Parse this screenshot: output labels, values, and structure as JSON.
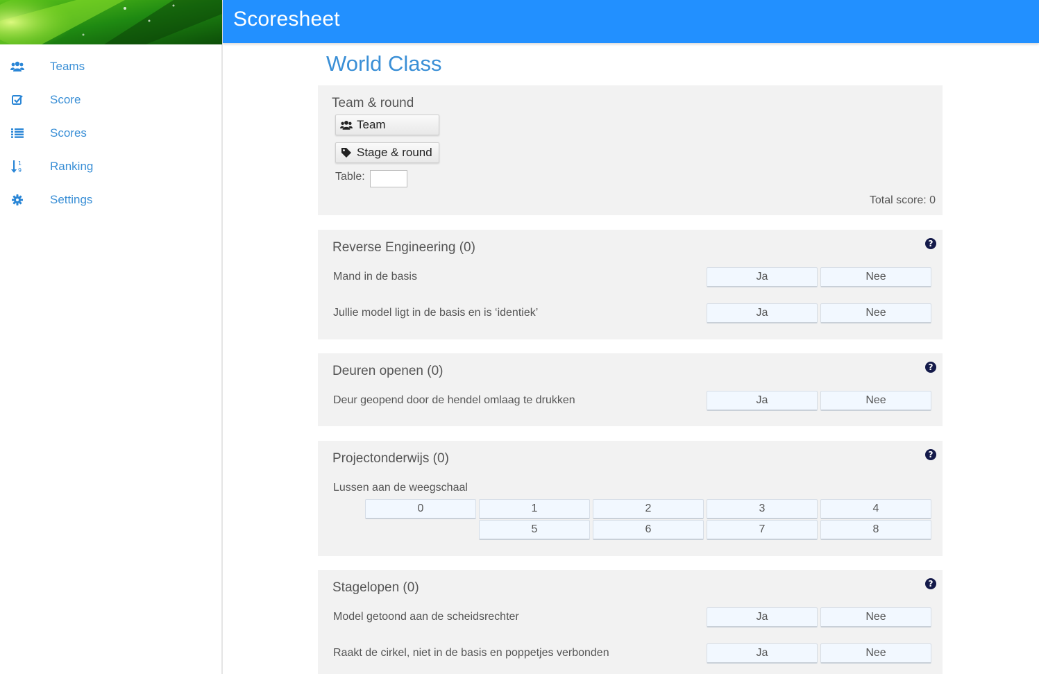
{
  "header": {
    "title": "Scoresheet"
  },
  "sidebar": {
    "items": [
      {
        "label": "Teams",
        "icon": "users-icon"
      },
      {
        "label": "Score",
        "icon": "check-square-icon"
      },
      {
        "label": "Scores",
        "icon": "list-icon"
      },
      {
        "label": "Ranking",
        "icon": "sort-numeric-icon"
      },
      {
        "label": "Settings",
        "icon": "gear-icon"
      }
    ]
  },
  "main": {
    "title": "World Class",
    "team_round": {
      "title": "Team & round",
      "team_button": "Team",
      "stage_button": "Stage & round",
      "table_label": "Table:",
      "table_value": "",
      "total_score": "Total score: 0"
    },
    "missions": [
      {
        "title": "Reverse Engineering (0)",
        "questions": [
          {
            "label": "Mand in de basis",
            "options": [
              "Ja",
              "Nee"
            ]
          },
          {
            "label": "Jullie model ligt in de basis en is ‘identiek’",
            "options": [
              "Ja",
              "Nee"
            ]
          }
        ]
      },
      {
        "title": "Deuren openen (0)",
        "questions": [
          {
            "label": "Deur geopend door de hendel omlaag te drukken",
            "options": [
              "Ja",
              "Nee"
            ]
          }
        ]
      },
      {
        "title": "Projectonderwijs (0)",
        "questions": [
          {
            "label": "Lussen aan de weegschaal",
            "options": [
              "0",
              "1",
              "2",
              "3",
              "4",
              "5",
              "6",
              "7",
              "8"
            ]
          }
        ]
      },
      {
        "title": "Stagelopen (0)",
        "questions": [
          {
            "label": "Model getoond aan de scheidsrechter",
            "options": [
              "Ja",
              "Nee"
            ]
          },
          {
            "label": "Raakt de cirkel, niet in de basis en poppetjes verbonden",
            "options": [
              "Ja",
              "Nee"
            ]
          }
        ]
      }
    ]
  },
  "colors": {
    "accent": "#2290ff",
    "link": "#3a8fd6",
    "panel": "#f2f2f2",
    "help": "#141a4a"
  }
}
